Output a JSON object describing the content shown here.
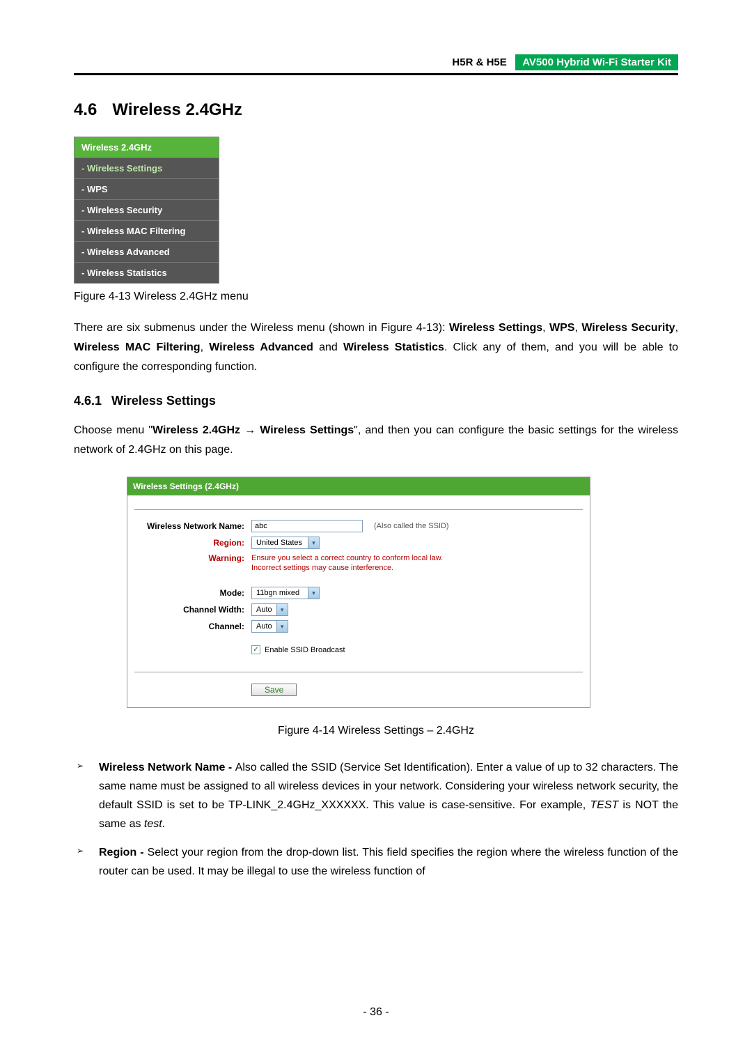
{
  "header": {
    "model": "H5R & H5E",
    "badge": "AV500 Hybrid Wi-Fi Starter Kit"
  },
  "section": {
    "number": "4.6",
    "title": "Wireless 2.4GHz"
  },
  "menu": {
    "title": "Wireless 2.4GHz",
    "items": [
      {
        "label": "- Wireless Settings",
        "active": true
      },
      {
        "label": "- WPS",
        "active": false
      },
      {
        "label": "- Wireless Security",
        "active": false
      },
      {
        "label": "- Wireless MAC Filtering",
        "active": false
      },
      {
        "label": "- Wireless Advanced",
        "active": false
      },
      {
        "label": "- Wireless Statistics",
        "active": false
      }
    ]
  },
  "figcap1": "Figure 4-13 Wireless 2.4GHz menu",
  "para1_a": "There are six submenus under the Wireless menu (shown in Figure 4-13): ",
  "para1_b1": "Wireless Settings",
  "para1_b2": "WPS",
  "para1_b3": "Wireless Security",
  "para1_b4": "Wireless MAC Filtering",
  "para1_b5": "Wireless Advanced",
  "para1_b6": "Wireless Statistics",
  "para1_c": ". Click any of them, and you will be able to configure the corresponding function.",
  "subsection": {
    "number": "4.6.1",
    "title": "Wireless Settings"
  },
  "para2_a": "Choose menu \"",
  "para2_b1": "Wireless 2.4GHz",
  "para2_arrow": "→",
  "para2_b2": "Wireless Settings",
  "para2_c": "\", and then you can configure the basic settings for the wireless network of 2.4GHz on this page.",
  "settings": {
    "title": "Wireless Settings (2.4GHz)",
    "ssid_label": "Wireless Network Name:",
    "ssid_value": "abc",
    "ssid_hint": "(Also called the SSID)",
    "region_label": "Region:",
    "region_value": "United States",
    "warning_label": "Warning:",
    "warning_text1": "Ensure you select a correct country to conform local law.",
    "warning_text2": "Incorrect settings may cause interference.",
    "mode_label": "Mode:",
    "mode_value": "11bgn mixed",
    "cw_label": "Channel Width:",
    "cw_value": "Auto",
    "ch_label": "Channel:",
    "ch_value": "Auto",
    "broadcast_label": "Enable SSID Broadcast",
    "save": "Save"
  },
  "figcap2": "Figure 4-14 Wireless Settings – 2.4GHz",
  "bullets": {
    "b1_label": "Wireless Network Name - ",
    "b1_text_a": "Also called the SSID (Service Set Identification). Enter a value of up to 32 characters. The same name must be assigned to all wireless devices in your network. Considering your wireless network security, the default SSID is set to be TP-LINK_2.4GHz_XXXXXX. This value is case-sensitive. For example, ",
    "b1_italic1": "TEST",
    "b1_text_b": " is NOT the same as ",
    "b1_italic2": "test",
    "b1_text_c": ".",
    "b2_label": "Region - ",
    "b2_text": "Select your region from the drop-down list. This field specifies the region where the wireless function of the router can be used. It may be illegal to use the wireless function of"
  },
  "pagenum": "- 36 -"
}
